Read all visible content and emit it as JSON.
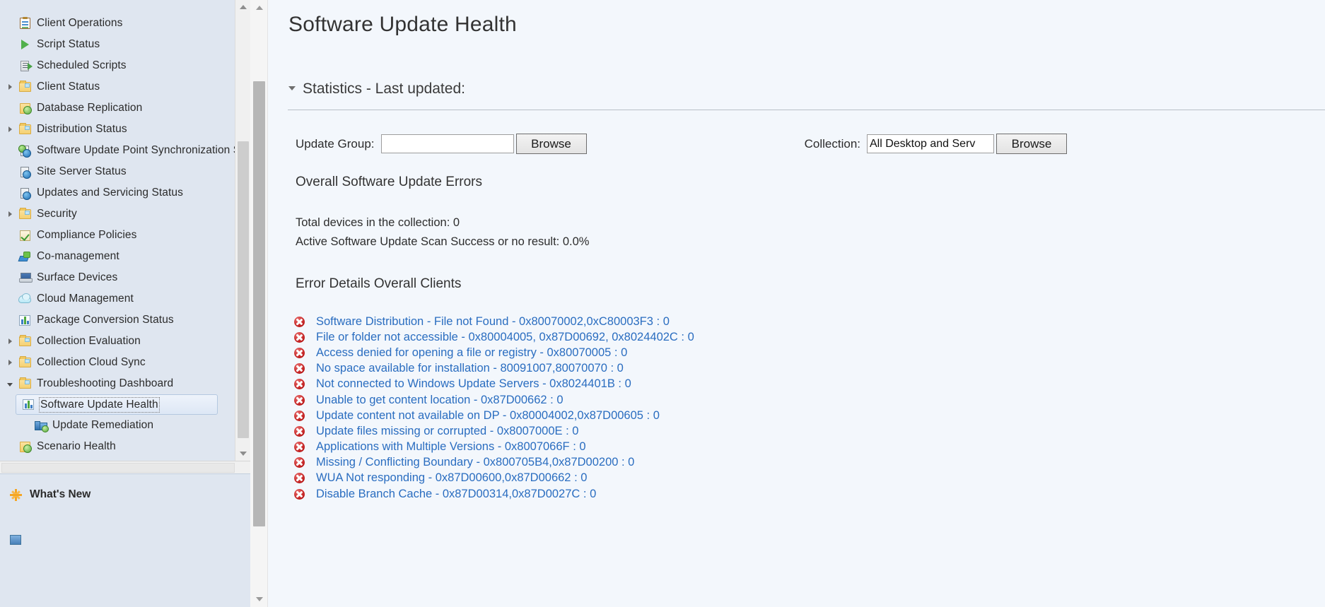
{
  "sidebar": {
    "tree": [
      {
        "label": "Client Operations",
        "icon": "clipboard-icon",
        "expander": "none",
        "indent": 0
      },
      {
        "label": "Script Status",
        "icon": "play-icon",
        "expander": "none",
        "indent": 0
      },
      {
        "label": "Scheduled Scripts",
        "icon": "script-arrow-icon",
        "expander": "none",
        "indent": 0
      },
      {
        "label": "Client Status",
        "icon": "folder-icon",
        "expander": "collapsed",
        "indent": 0
      },
      {
        "label": "Database Replication",
        "icon": "database-replication-icon",
        "expander": "none",
        "indent": 0
      },
      {
        "label": "Distribution Status",
        "icon": "folder-icon",
        "expander": "collapsed",
        "indent": 0
      },
      {
        "label": "Software Update Point Synchronization Sta",
        "icon": "sync-server-icon",
        "expander": "none",
        "indent": 0
      },
      {
        "label": "Site Server Status",
        "icon": "server-info-icon",
        "expander": "none",
        "indent": 0
      },
      {
        "label": "Updates and Servicing Status",
        "icon": "server-info-icon",
        "expander": "none",
        "indent": 0
      },
      {
        "label": "Security",
        "icon": "folder-icon",
        "expander": "collapsed",
        "indent": 0
      },
      {
        "label": "Compliance Policies",
        "icon": "compliance-check-icon",
        "expander": "none",
        "indent": 0
      },
      {
        "label": "Co-management",
        "icon": "plug-icon",
        "expander": "none",
        "indent": 0
      },
      {
        "label": "Surface Devices",
        "icon": "laptop-icon",
        "expander": "none",
        "indent": 0
      },
      {
        "label": "Cloud Management",
        "icon": "cloud-icon",
        "expander": "none",
        "indent": 0
      },
      {
        "label": "Package Conversion Status",
        "icon": "bar-chart-icon",
        "expander": "none",
        "indent": 0
      },
      {
        "label": "Collection Evaluation",
        "icon": "folder-icon",
        "expander": "collapsed",
        "indent": 0
      },
      {
        "label": "Collection Cloud Sync",
        "icon": "folder-icon",
        "expander": "collapsed",
        "indent": 0
      },
      {
        "label": "Troubleshooting Dashboard",
        "icon": "folder-icon",
        "expander": "expanded",
        "indent": 0
      },
      {
        "label": "Software Update Health",
        "icon": "bar-chart-icon",
        "expander": "none",
        "indent": 1,
        "selected": true
      },
      {
        "label": "Update Remediation",
        "icon": "update-remediation-icon",
        "expander": "none",
        "indent": 1
      },
      {
        "label": "Scenario Health",
        "icon": "database-replication-icon",
        "expander": "none",
        "indent": 0
      }
    ],
    "bottom_nav": [
      {
        "label": "What's New",
        "icon": "sunburst-icon"
      }
    ]
  },
  "main": {
    "page_title": "Software Update Health",
    "statistics_section": {
      "label": "Statistics - Last updated:"
    },
    "update_group": {
      "label": "Update Group:",
      "value": "",
      "placeholder": "",
      "browse_label": "Browse"
    },
    "collection": {
      "label": "Collection:",
      "value": "All Desktop and Serv",
      "placeholder": "",
      "browse_label": "Browse"
    },
    "overall_errors_heading": "Overall Software Update Errors",
    "stats": [
      "Total devices in the collection: 0",
      "Active Software Update Scan Success or no result: 0.0%"
    ],
    "error_details_heading": "Error Details Overall Clients",
    "errors": [
      "Software Distribution - File not Found - 0x80070002,0xC80003F3 : 0",
      "File or folder not accessible - 0x80004005, 0x87D00692, 0x8024402C : 0",
      "Access denied for opening a file or registry - 0x80070005 : 0",
      "No space available for installation - 80091007,80070070 : 0",
      "Not connected to Windows Update Servers - 0x8024401B  : 0",
      "Unable to get content location - 0x87D00662  : 0",
      "Update content not available on DP - 0x80004002,0x87D00605 : 0",
      "Update files missing or corrupted - 0x8007000E : 0",
      "Applications with Multiple Versions - 0x8007066F : 0",
      "Missing / Conflicting Boundary - 0x800705B4,0x87D00200 : 0",
      "WUA Not responding - 0x87D00600,0x87D00662 : 0",
      "Disable Branch Cache - 0x87D00314,0x87D0027C : 0"
    ]
  },
  "colors": {
    "link": "#2a6dc0",
    "error_badge": "#c01e1e",
    "sidebar_bg": "#dfe6f0",
    "main_bg": "#f3f7fc"
  }
}
